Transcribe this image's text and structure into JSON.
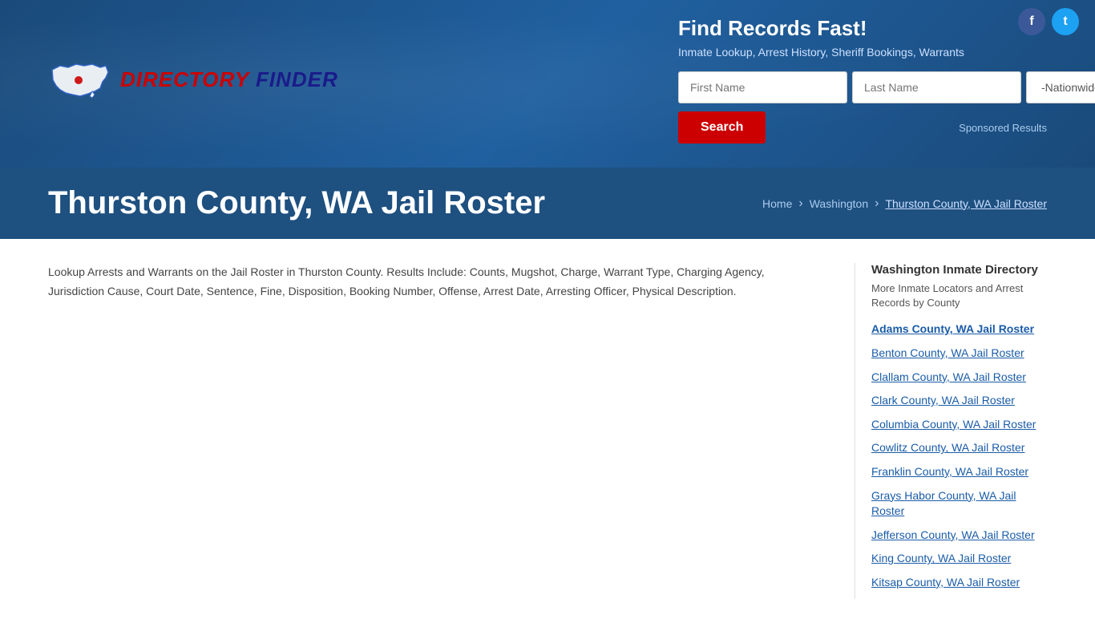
{
  "social": {
    "facebook_label": "f",
    "twitter_label": "t"
  },
  "header": {
    "logo_text_directory": "Directory",
    "logo_text_finder": "Finder",
    "search_title": "Find Records Fast!",
    "search_subtitle": "Inmate Lookup, Arrest History, Sheriff Bookings, Warrants",
    "first_name_placeholder": "First Name",
    "last_name_placeholder": "Last Name",
    "nationwide_option": "-Nationwide-",
    "search_button_label": "Search",
    "sponsored_label": "Sponsored Results"
  },
  "page": {
    "title": "Thurston County, WA Jail Roster",
    "breadcrumb_home": "Home",
    "breadcrumb_state": "Washington",
    "breadcrumb_current": "Thurston County, WA Jail Roster"
  },
  "main": {
    "description": "Lookup Arrests and Warrants on the Jail Roster in Thurston County. Results Include: Counts, Mugshot, Charge, Warrant Type, Charging Agency, Jurisdiction Cause, Court Date, Sentence, Fine, Disposition, Booking Number, Offense, Arrest Date, Arresting Officer, Physical Description."
  },
  "sidebar": {
    "title": "Washington Inmate Directory",
    "subtitle": "More Inmate Locators and Arrest Records by County",
    "links": [
      {
        "label": "Adams County, WA Jail Roster",
        "active": true
      },
      {
        "label": "Benton County, WA Jail Roster",
        "active": false
      },
      {
        "label": "Clallam County, WA Jail Roster",
        "active": false
      },
      {
        "label": "Clark County, WA Jail Roster",
        "active": false
      },
      {
        "label": "Columbia County, WA Jail Roster",
        "active": false
      },
      {
        "label": "Cowlitz County, WA Jail Roster",
        "active": false
      },
      {
        "label": "Franklin County, WA Jail Roster",
        "active": false
      },
      {
        "label": "Grays Habor County, WA Jail Roster",
        "active": false
      },
      {
        "label": "Jefferson County, WA Jail Roster",
        "active": false
      },
      {
        "label": "King County, WA Jail Roster",
        "active": false
      },
      {
        "label": "Kitsap County, WA Jail Roster",
        "active": false
      }
    ]
  }
}
